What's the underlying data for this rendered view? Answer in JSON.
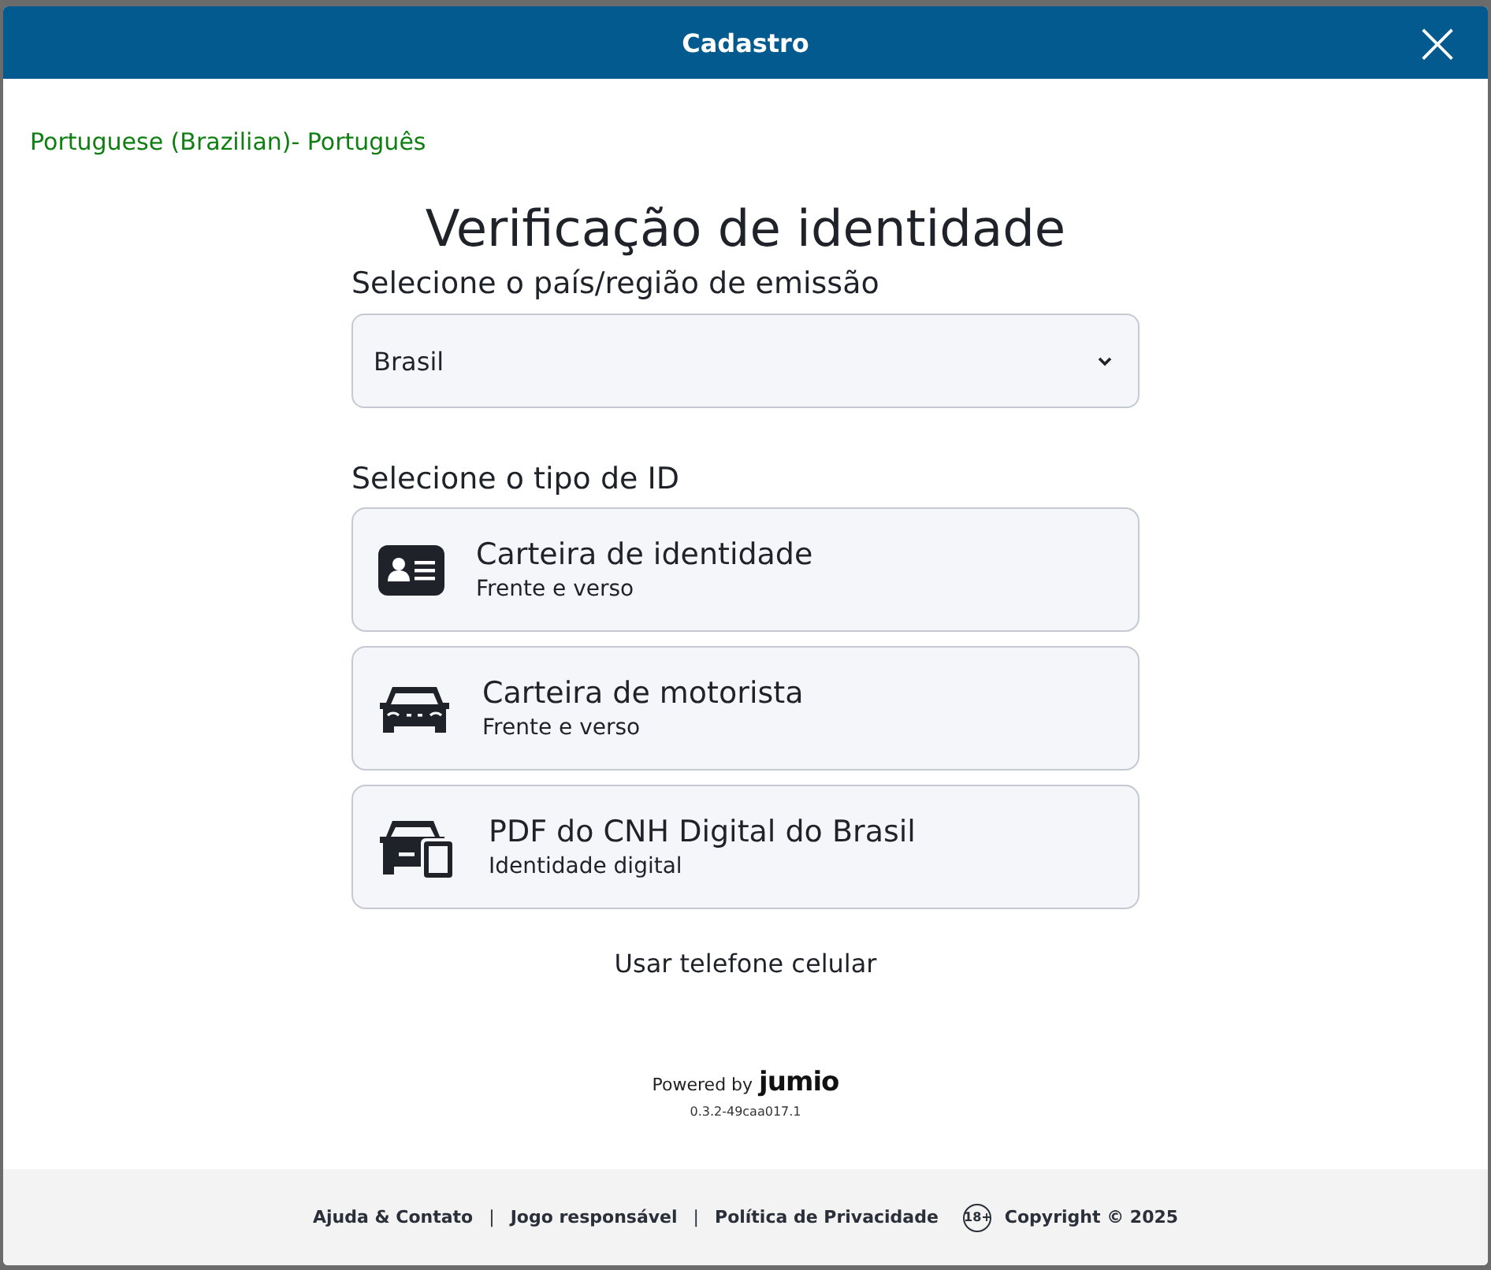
{
  "window": {
    "title": "Cadastro",
    "close": "×"
  },
  "language": "Portuguese (Brazilian)- Português",
  "heading": "Verificação de identidade",
  "country": {
    "label": "Selecione o país/região de emissão",
    "value": "Brasil"
  },
  "id_types": {
    "label": "Selecione o tipo de ID",
    "options": [
      {
        "kind": "id-card",
        "title": "Carteira de identidade",
        "subtitle": "Frente e verso"
      },
      {
        "kind": "car",
        "title": "Carteira de motorista",
        "subtitle": "Frente e verso"
      },
      {
        "kind": "car-phone",
        "title": "PDF do CNH Digital do Brasil",
        "subtitle": "Identidade digital"
      }
    ]
  },
  "mobile_link": "Usar telefone celular",
  "powered_by": {
    "text": "Powered by",
    "brand": "jumio",
    "version": "0.3.2-49caa017.1"
  },
  "footer": {
    "links": [
      "Ajuda & Contato",
      "Jogo responsável",
      "Política de Privacidade"
    ],
    "separator": "|",
    "age_badge": "18+",
    "copyright": "Copyright © 2025"
  }
}
